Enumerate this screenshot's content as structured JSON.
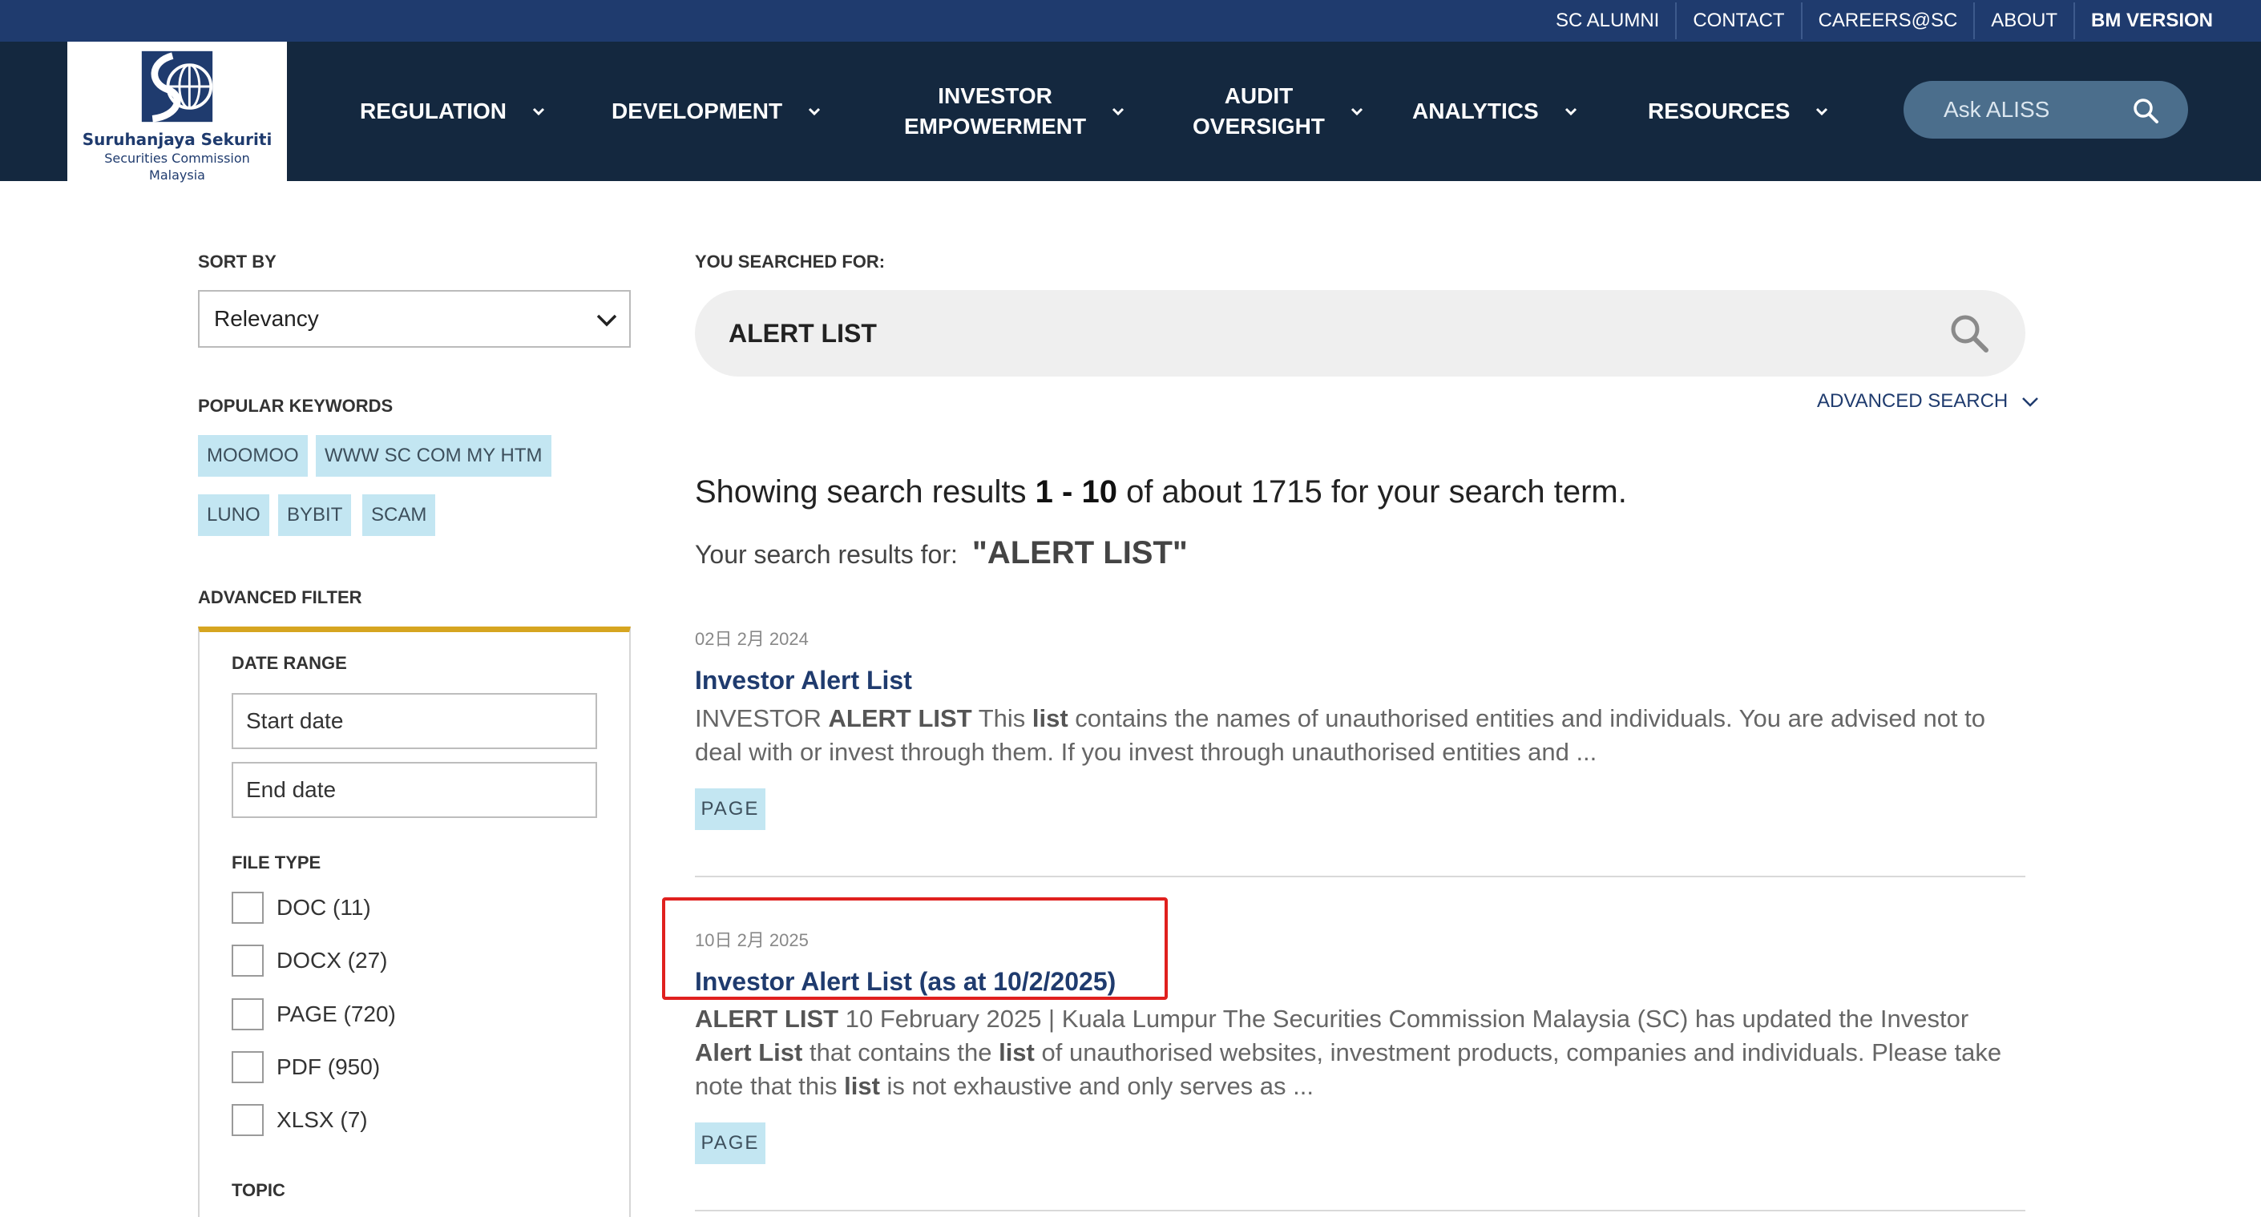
{
  "utility_bar": {
    "links": [
      "SC ALUMNI",
      "CONTACT",
      "CAREERS@SC",
      "ABOUT",
      "BM VERSION"
    ]
  },
  "logo": {
    "line1": "Suruhanjaya Sekuriti",
    "line2": "Securities Commission",
    "line3": "Malaysia"
  },
  "nav": {
    "items": [
      {
        "line1": "REGULATION",
        "line2": ""
      },
      {
        "line1": "DEVELOPMENT",
        "line2": ""
      },
      {
        "line1": "INVESTOR",
        "line2": "EMPOWERMENT"
      },
      {
        "line1": "AUDIT",
        "line2": "OVERSIGHT"
      },
      {
        "line1": "ANALYTICS",
        "line2": ""
      },
      {
        "line1": "RESOURCES",
        "line2": ""
      }
    ],
    "ask_label": "Ask ALISS"
  },
  "sidebar": {
    "sort_by_heading": "SORT BY",
    "sort_value": "Relevancy",
    "popular_heading": "POPULAR KEYWORDS",
    "keywords": [
      "MOOMOO",
      "WWW SC COM MY HTM",
      "LUNO",
      "BYBIT",
      "SCAM"
    ],
    "advanced_filter_heading": "ADVANCED FILTER",
    "date_range_heading": "DATE RANGE",
    "start_date_placeholder": "Start date",
    "end_date_placeholder": "End date",
    "file_type_heading": "FILE TYPE",
    "file_types": [
      "DOC (11)",
      "DOCX (27)",
      "PAGE (720)",
      "PDF (950)",
      "XLSX (7)"
    ],
    "topic_heading": "TOPIC"
  },
  "search": {
    "you_searched_for": "YOU SEARCHED FOR:",
    "query": "ALERT LIST",
    "advanced_search": "ADVANCED SEARCH"
  },
  "summary": {
    "prefix": "Showing search results ",
    "range": "1 - 10",
    "suffix": " of about 1715 for your search term.",
    "results_for_label": "Your search results for:",
    "results_for_term": "\"ALERT LIST\""
  },
  "results": [
    {
      "date": "02日 2月 2024",
      "title": "Investor Alert List",
      "snippet_parts": [
        {
          "t": "INVESTOR "
        },
        {
          "t": "ALERT LIST",
          "b": true
        },
        {
          "t": " This "
        },
        {
          "t": "list",
          "b": true
        },
        {
          "t": " contains the names of unauthorised entities and individuals. You are advised not to deal with or invest through them. If you invest through unauthorised entities and ..."
        }
      ],
      "tag": "PAGE"
    },
    {
      "date": "10日 2月 2025",
      "title": "Investor Alert List (as at 10/2/2025)",
      "snippet_parts": [
        {
          "t": "ALERT LIST",
          "b": true
        },
        {
          "t": " 10 February 2025 | Kuala Lumpur The Securities Commission Malaysia (SC) has updated the Investor "
        },
        {
          "t": "Alert List",
          "b": true
        },
        {
          "t": " that contains the "
        },
        {
          "t": "list",
          "b": true
        },
        {
          "t": " of unauthorised websites, investment products, companies and individuals. Please take note that this "
        },
        {
          "t": "list",
          "b": true
        },
        {
          "t": " is not exhaustive and only serves as ..."
        }
      ],
      "tag": "PAGE"
    }
  ],
  "colors": {
    "utility_bar": "#1f3b6e",
    "main_nav": "#14283f",
    "accent_gold": "#d6a520",
    "tag_bg": "#c3e6f2",
    "highlight_red": "#e0201e",
    "title_blue": "#1f3b6e"
  }
}
